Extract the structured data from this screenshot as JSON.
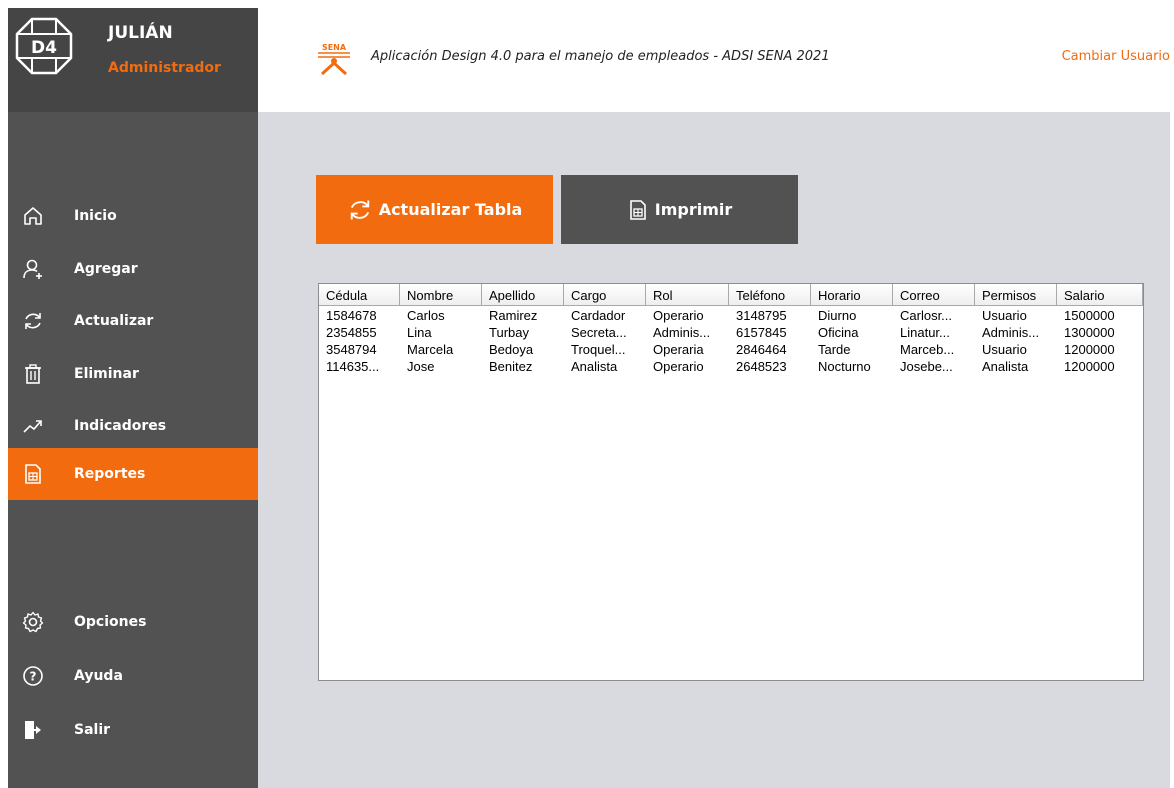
{
  "user": {
    "name": "JULIÁN",
    "role": "Administrador",
    "logo_text": "D4"
  },
  "header": {
    "sena_label": "SENA",
    "title": "Aplicación Design 4.0 para el manejo de empleados - ADSI SENA 2021",
    "change_user": "Cambiar Usuario"
  },
  "nav": {
    "inicio": "Inicio",
    "agregar": "Agregar",
    "actualizar": "Actualizar",
    "eliminar": "Eliminar",
    "indicadores": "Indicadores",
    "reportes": "Reportes",
    "opciones": "Opciones",
    "ayuda": "Ayuda",
    "salir": "Salir"
  },
  "buttons": {
    "refresh": "Actualizar Tabla",
    "print": "Imprimir"
  },
  "colors": {
    "accent": "#f26b0f",
    "sidebar": "#525252",
    "sidebar_top": "#454545",
    "content_bg": "#d8dadf"
  },
  "table": {
    "columns": [
      "Cédula",
      "Nombre",
      "Apellido",
      "Cargo",
      "Rol",
      "Teléfono",
      "Horario",
      "Correo",
      "Permisos",
      "Salario"
    ],
    "rows": [
      [
        "1584678",
        "Carlos",
        "Ramirez",
        "Cardador",
        "Operario",
        "3148795",
        "Diurno",
        "Carlosr...",
        "Usuario",
        "1500000"
      ],
      [
        "2354855",
        "Lina",
        "Turbay",
        "Secreta...",
        "Adminis...",
        "6157845",
        "Oficina",
        "Linatur...",
        "Adminis...",
        "1300000"
      ],
      [
        "3548794",
        "Marcela",
        "Bedoya",
        "Troquel...",
        "Operaria",
        "2846464",
        "Tarde",
        "Marceb...",
        "Usuario",
        "1200000"
      ],
      [
        "114635...",
        "Jose",
        "Benitez",
        "Analista",
        "Operario",
        "2648523",
        "Nocturno",
        "Josebe...",
        "Analista",
        "1200000"
      ]
    ]
  }
}
